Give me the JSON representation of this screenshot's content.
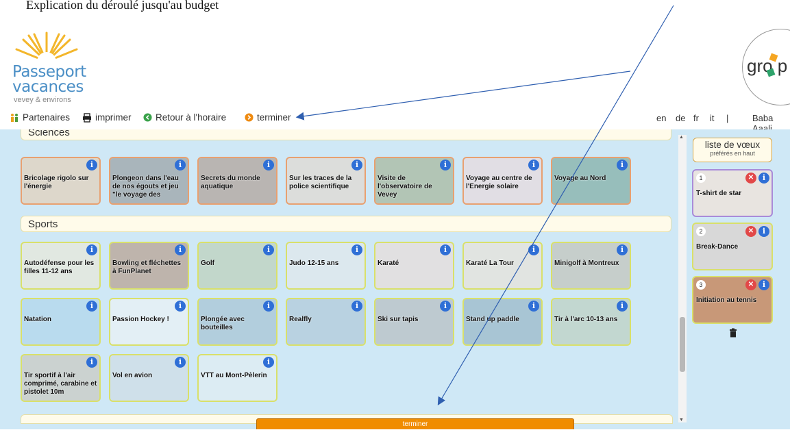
{
  "caption": "Explication du déroulé jusqu'au budget",
  "logo": {
    "line1": "Passeport",
    "line2": "vacances",
    "line3": "vevey & environs"
  },
  "partner_logo": {
    "text": "gro p"
  },
  "nav": {
    "partners": "Partenaires",
    "print": "imprimer",
    "back": "Retour à l'horaire",
    "finish": "terminer"
  },
  "languages": [
    "en",
    "de",
    "fr",
    "it"
  ],
  "separator": "|",
  "user": "Baba Aaali",
  "sections": {
    "sciences": "Sciences",
    "sports": "Sports"
  },
  "sciences_cards": [
    {
      "title": "Bricolage rigolo sur l'énergie",
      "color": "#e9c9a8"
    },
    {
      "title": "Plongeon dans l'eau de nos égouts et jeu \"le voyage des",
      "color": "#8a8a8a"
    },
    {
      "title": "Secrets du monde aquatique",
      "color": "#a88a7a"
    },
    {
      "title": "Sur les traces de la police scientifique",
      "color": "#e7d4c4"
    },
    {
      "title": "Visite de l'observatoire de Vevey",
      "color": "#9aa880"
    },
    {
      "title": "Voyage au centre de l'Energie solaire",
      "color": "#f0d6d6"
    },
    {
      "title": "Voyage au Nord",
      "color": "#6a9a8a"
    }
  ],
  "sports_cards": [
    {
      "title": "Autodéfense pour les filles 11-12 ans",
      "color": "#f0e8d0"
    },
    {
      "title": "Bowling et fléchettes à FunPlanet",
      "color": "#b08870"
    },
    {
      "title": "Golf",
      "color": "#b8c8a8"
    },
    {
      "title": "Judo 12-15 ans",
      "color": "#e8e8e8"
    },
    {
      "title": "Karaté",
      "color": "#f0d8d0"
    },
    {
      "title": "Karaté La Tour",
      "color": "#f0e0d0"
    },
    {
      "title": "Minigolf à Montreux",
      "color": "#c0b8a8"
    },
    {
      "title": "Natation",
      "color": "#a8d0e8"
    },
    {
      "title": "Passion Hockey !",
      "color": "#f4f4f4"
    },
    {
      "title": "Plongée avec bouteilles",
      "color": "#9ab8c8"
    },
    {
      "title": "Realfly",
      "color": "#a8c0d0"
    },
    {
      "title": "Ski sur tapis",
      "color": "#b0b0b0"
    },
    {
      "title": "Stand up paddle",
      "color": "#88a8b8"
    },
    {
      "title": "Tir à l'arc 10-13 ans",
      "color": "#b8c8b0"
    },
    {
      "title": "Tir sportif à l'air comprimé, carabine et pistolet 10m",
      "color": "#c8c0b0"
    },
    {
      "title": "Vol en avion",
      "color": "#d0d8e0"
    },
    {
      "title": "VTT au Mont-Pèlerin",
      "color": "#e8eef0"
    }
  ],
  "info_icon": "i",
  "wishlist": {
    "title": "liste de vœux",
    "subtitle": "préférés en haut",
    "items": [
      {
        "num": "1",
        "label": "T-shirt de star",
        "border": "#a98bd9",
        "color": "#e8e4e0"
      },
      {
        "num": "2",
        "label": "Break-Dance",
        "border": "#d9e06a",
        "color": "#d8d8d8"
      },
      {
        "num": "3",
        "label": "Initiation au tennis",
        "border": "#d9e06a",
        "color": "#c89878"
      }
    ],
    "remove_icon": "✕"
  },
  "finish_button": "terminer",
  "colors": {
    "panel_bg": "#cfe8f6",
    "info_blue": "#2f6fd6",
    "finish_orange": "#f08c00",
    "arrow_blue": "#2f5fb0"
  }
}
